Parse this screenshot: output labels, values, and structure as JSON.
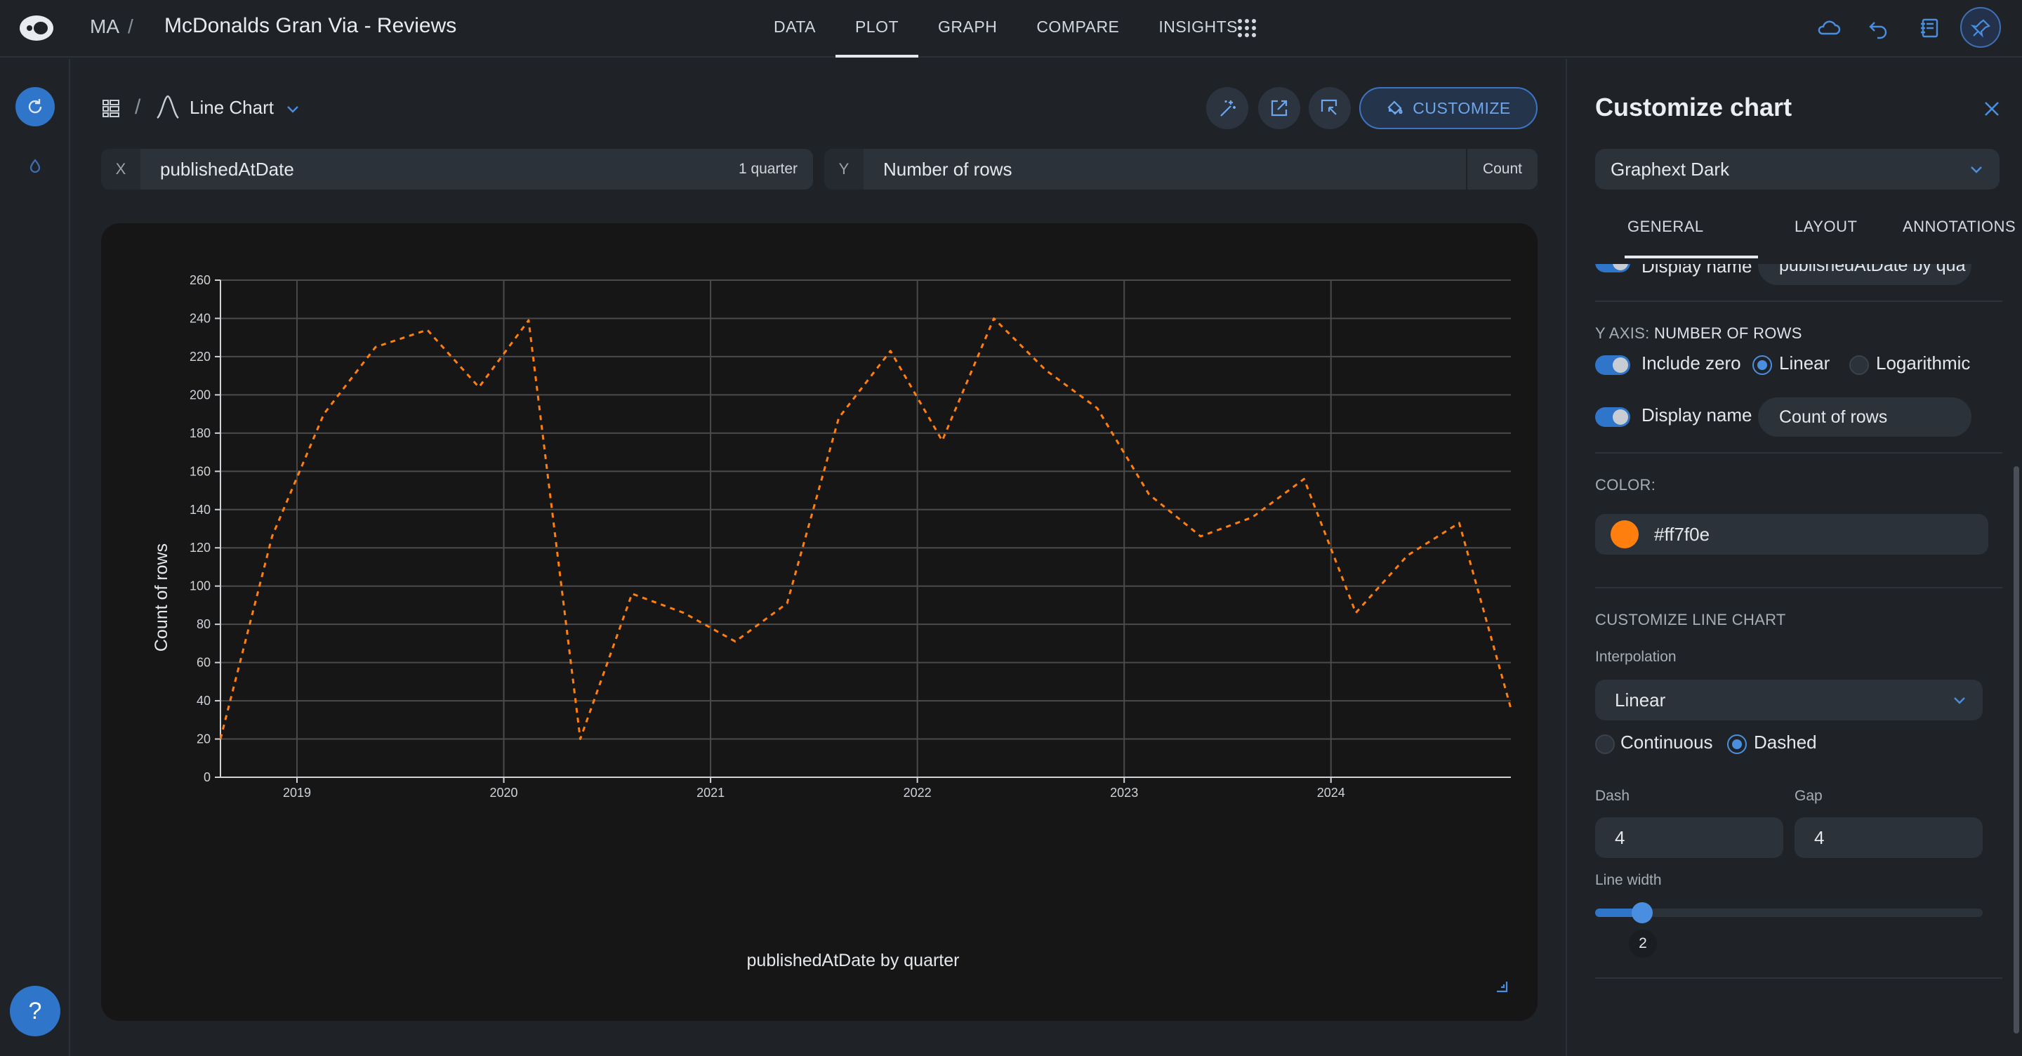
{
  "topbar": {
    "workspace": "MA",
    "separator": "/",
    "project_title": "McDonalds Gran Via - Reviews",
    "nav_tabs": [
      {
        "label": "DATA",
        "active": false
      },
      {
        "label": "PLOT",
        "active": true
      },
      {
        "label": "GRAPH",
        "active": false
      },
      {
        "label": "COMPARE",
        "active": false
      },
      {
        "label": "INSIGHTS",
        "active": false
      }
    ],
    "icons": [
      "logo-icon",
      "apps-grid-icon",
      "cloud-icon",
      "undo-icon",
      "notebook-icon",
      "pin-icon"
    ]
  },
  "left_rail": {
    "help_label": "?",
    "icons": [
      "refresh-icon",
      "drop-icon"
    ]
  },
  "plot_header": {
    "separator": "/",
    "chart_type_label": "Line Chart",
    "customize_label": "CUSTOMIZE",
    "tool_icons": [
      "magic-icon",
      "export-icon",
      "screenshot-icon"
    ]
  },
  "x_field": {
    "tag": "X",
    "value": "publishedAtDate",
    "aggregation": "1 quarter"
  },
  "y_field": {
    "tag": "Y",
    "value": "Number of rows",
    "aggregation": "Count"
  },
  "chart_data": {
    "type": "line",
    "xlabel": "publishedAtDate by quarter",
    "ylabel": "Count of rows",
    "x_tick_labels": [
      "2019",
      "2020",
      "2021",
      "2022",
      "2023",
      "2024"
    ],
    "y_ticks": [
      0,
      20,
      40,
      60,
      80,
      100,
      120,
      140,
      160,
      180,
      200,
      220,
      240,
      260
    ],
    "ylim": [
      0,
      260
    ],
    "x_range_years": [
      2018.63,
      2024.87
    ],
    "grid": true,
    "line_style": "dashed",
    "color": "#ff7f0e",
    "series": [
      {
        "x": [
          2018.63,
          2018.88,
          2019.13,
          2019.38,
          2019.63,
          2019.88,
          2020.12,
          2020.37,
          2020.62,
          2020.87,
          2021.12,
          2021.37,
          2021.62,
          2021.87,
          2022.12,
          2022.37,
          2022.62,
          2022.87,
          2023.12,
          2023.37,
          2023.62,
          2023.87,
          2024.12,
          2024.37,
          2024.62,
          2024.87
        ],
        "values": [
          20,
          126,
          190,
          225,
          234,
          204,
          239,
          20,
          96,
          86,
          71,
          91,
          188,
          223,
          176,
          240,
          213,
          193,
          148,
          126,
          136,
          156,
          86,
          116,
          133,
          36
        ]
      }
    ]
  },
  "side_panel": {
    "title": "Customize chart",
    "theme_value": "Graphext Dark",
    "tabs": [
      "GENERAL",
      "LAYOUT",
      "ANNOTATIONS"
    ],
    "active_tab": "GENERAL",
    "x_axis_partial": {
      "label": "Display name",
      "value": "publishedAtDate by qua"
    },
    "y_axis": {
      "section_prefix": "Y AXIS:",
      "section_name": "NUMBER OF ROWS",
      "include_zero_label": "Include zero",
      "include_zero": true,
      "scale_options": [
        "Linear",
        "Logarithmic"
      ],
      "scale_selected": "Linear",
      "display_name_label": "Display name",
      "display_name_enabled": true,
      "display_name_value": "Count of rows"
    },
    "color": {
      "section_label": "COLOR:",
      "value": "#ff7f0e",
      "text": "#ff7f0e"
    },
    "line_chart": {
      "section_label": "CUSTOMIZE LINE CHART",
      "interpolation_label": "Interpolation",
      "interpolation_value": "Linear",
      "line_modes": [
        "Continuous",
        "Dashed"
      ],
      "line_mode_selected": "Dashed",
      "dash_label": "Dash",
      "dash_value": "4",
      "gap_label": "Gap",
      "gap_value": "4",
      "line_width_label": "Line width",
      "line_width_value": "2"
    }
  }
}
